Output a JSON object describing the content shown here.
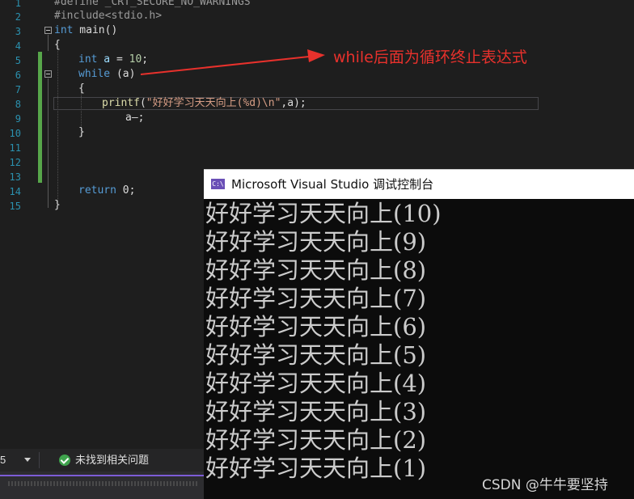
{
  "editor": {
    "line_numbers": [
      "1",
      "2",
      "3",
      "4",
      "5",
      "6",
      "7",
      "8",
      "9",
      "10",
      "11",
      "12",
      "13",
      "14",
      "15"
    ],
    "code": {
      "l1": "#define _CRT_SECURE_NO_WARNINGS",
      "l2": "#include<stdio.h>",
      "l3_kw": "int",
      "l3_rest": " main()",
      "l4": "{",
      "l5_kw": "int",
      "l5_var": " a",
      "l5_eq": " = ",
      "l5_num": "10",
      "l5_end": ";",
      "l6_kw": "while",
      "l6_rest": " (a)",
      "l7": "{",
      "l8_fn": "printf",
      "l8_open": "(",
      "l8_str": "\"好好学习天天向上(%d)\\n\"",
      "l8_rest": ",a);",
      "l9": "a—;",
      "l10": "}",
      "l14_kw": "return",
      "l14_rest": " 0;",
      "l15": "}"
    }
  },
  "annotation": {
    "text": "while后面为循环终止表达式",
    "color": "#e8312c"
  },
  "status": {
    "zoom": "5",
    "issues": "未找到相关问题"
  },
  "console": {
    "icon_label": "C:\\",
    "title": "Microsoft Visual Studio 调试控制台",
    "output": [
      "好好学习天天向上(10)",
      "好好学习天天向上(9)",
      "好好学习天天向上(8)",
      "好好学习天天向上(7)",
      "好好学习天天向上(6)",
      "好好学习天天向上(5)",
      "好好学习天天向上(4)",
      "好好学习天天向上(3)",
      "好好学习天天向上(2)",
      "好好学习天天向上(1)"
    ]
  },
  "watermark": "CSDN @牛牛要坚持"
}
